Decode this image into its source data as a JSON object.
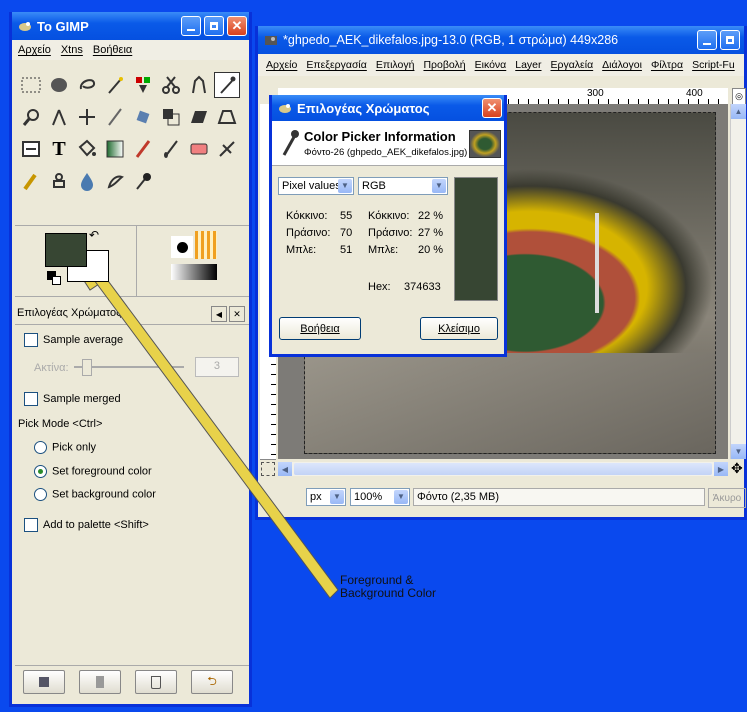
{
  "toolbox": {
    "title": "Το GIMP",
    "menu": [
      "Αρχείο",
      "Xtns",
      "Βοήθεια"
    ]
  },
  "tool_options": {
    "title": "Επιλογέας Χρώματος",
    "sample_average": "Sample average",
    "radius_label": "Ακτίνα:",
    "radius_value": "3",
    "sample_merged": "Sample merged",
    "pick_mode": "Pick Mode  <Ctrl>",
    "pick_only": "Pick only",
    "set_foreground": "Set foreground color",
    "set_background": "Set background color",
    "add_to_palette": "Add to palette  <Shift>"
  },
  "image_window": {
    "title": "*ghpedo_AEK_dikefalos.jpg-13.0 (RGB, 1 στρώμα) 449x286",
    "menu": [
      "Αρχείο",
      "Επεξεργασία",
      "Επιλογή",
      "Προβολή",
      "Εικόνα",
      "Layer",
      "Εργαλεία",
      "Διάλογοι",
      "Φίλτρα",
      "Script-Fu"
    ],
    "ruler_labels": [
      "300",
      "400"
    ],
    "unit": "px",
    "zoom": "100%",
    "status": "Φόντο (2,35 MB)",
    "cancel": "Άκυρο"
  },
  "picker_dialog": {
    "title": "Επιλογέας Χρώματος",
    "header": "Color Picker Information",
    "subheader": "Φόντο-26 (ghpedo_AEK_dikefalos.jpg)",
    "mode_left": "Pixel values",
    "mode_right": "RGB",
    "left_rows": [
      {
        "label": "Κόκκινο:",
        "value": "55"
      },
      {
        "label": "Πράσινο:",
        "value": "70"
      },
      {
        "label": "Μπλε:",
        "value": "51"
      }
    ],
    "right_rows": [
      {
        "label": "Κόκκινο:",
        "value": "22 %"
      },
      {
        "label": "Πράσινο:",
        "value": "27 %"
      },
      {
        "label": "Μπλε:",
        "value": "20 %"
      }
    ],
    "hex_label": "Hex:",
    "hex_value": "374633",
    "help_button": "Βοήθεια",
    "close_button": "Κλείσιμο",
    "swatch_color": "#374633"
  },
  "annotation": {
    "line1": "Foreground &",
    "line2": "Background Color"
  },
  "colors": {
    "foreground": "#374633",
    "background": "#ffffff",
    "desktop": "#0a49ee"
  }
}
